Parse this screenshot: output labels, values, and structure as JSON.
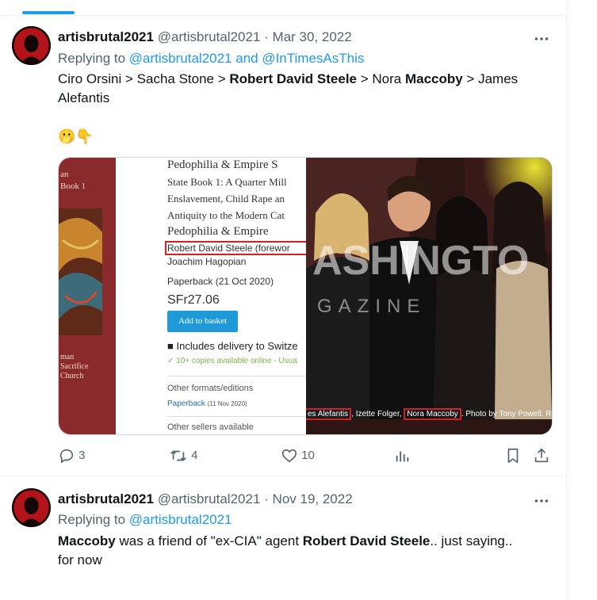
{
  "tweets": [
    {
      "name": "artisbrutal2021",
      "handle": "@artisbrutal2021",
      "separator": "·",
      "date": "Mar 30, 2022",
      "more_icon": "more-icon",
      "reply_prefix": "Replying to",
      "reply_mention": "@artisbrutal2021 and @InTimesAsThis",
      "body": {
        "t1": "Ciro Orsini > Sacha Stone > ",
        "b1": "Robert David Steele",
        "t2": " > Nora ",
        "b2": "Maccoby",
        "t3": " > James",
        "t4": "Alefantis"
      },
      "emoji": "🫢👇",
      "media": {
        "book_left_text": [
          "an",
          "Book 1"
        ],
        "book_left_bottom": [
          "man",
          "Sacrifice",
          "Church"
        ],
        "title_line1": "Pedophilia & Empire S",
        "subtitle_lines": [
          "State Book 1: A Quarter Mill",
          "Enslavement, Child Rape an",
          "Antiquity to the Modern Cat"
        ],
        "title_line2": "Pedophilia & Empire",
        "author_highlight": "Robert David Steele (forewor",
        "author2": "Joachim Hagopian",
        "format": "Paperback (21 Oct 2020)",
        "price": "SFr27.06",
        "add_button": "Add to basket",
        "delivery": "Includes delivery to Switze",
        "copies": "✓ 10+ copies available online - Usua",
        "other_formats": "Other formats/editions",
        "paperback2": "Paperback",
        "paperback2_date": "(11 Nov 2020)",
        "other_sellers": "Other sellers available",
        "watermark": "ASHINGTO",
        "watermark2": "GAZINE",
        "caption_parts": [
          "es Alefantis",
          ", Izette Folger, ",
          "Nora Maccoby",
          ". Photo by Tony Powell. Roc"
        ]
      },
      "actions": {
        "replies": "3",
        "reposts": "4",
        "likes": "10"
      }
    },
    {
      "name": "artisbrutal2021",
      "handle": "@artisbrutal2021",
      "separator": "·",
      "date": "Nov 19, 2022",
      "more_icon": "more-icon",
      "reply_prefix": "Replying to",
      "reply_mention": "@artisbrutal2021",
      "body": {
        "b1": "Maccoby",
        "t1": " was a friend of \"ex-CIA\" agent ",
        "b2": "Robert David Steele",
        "t2": ".. just saying..",
        "t3": "for now"
      }
    }
  ],
  "colors": {
    "accent": "#1d9bf0",
    "secondary_text": "#536471",
    "highlight_box": "#d0212a",
    "add_button": "#1f9ad6"
  }
}
